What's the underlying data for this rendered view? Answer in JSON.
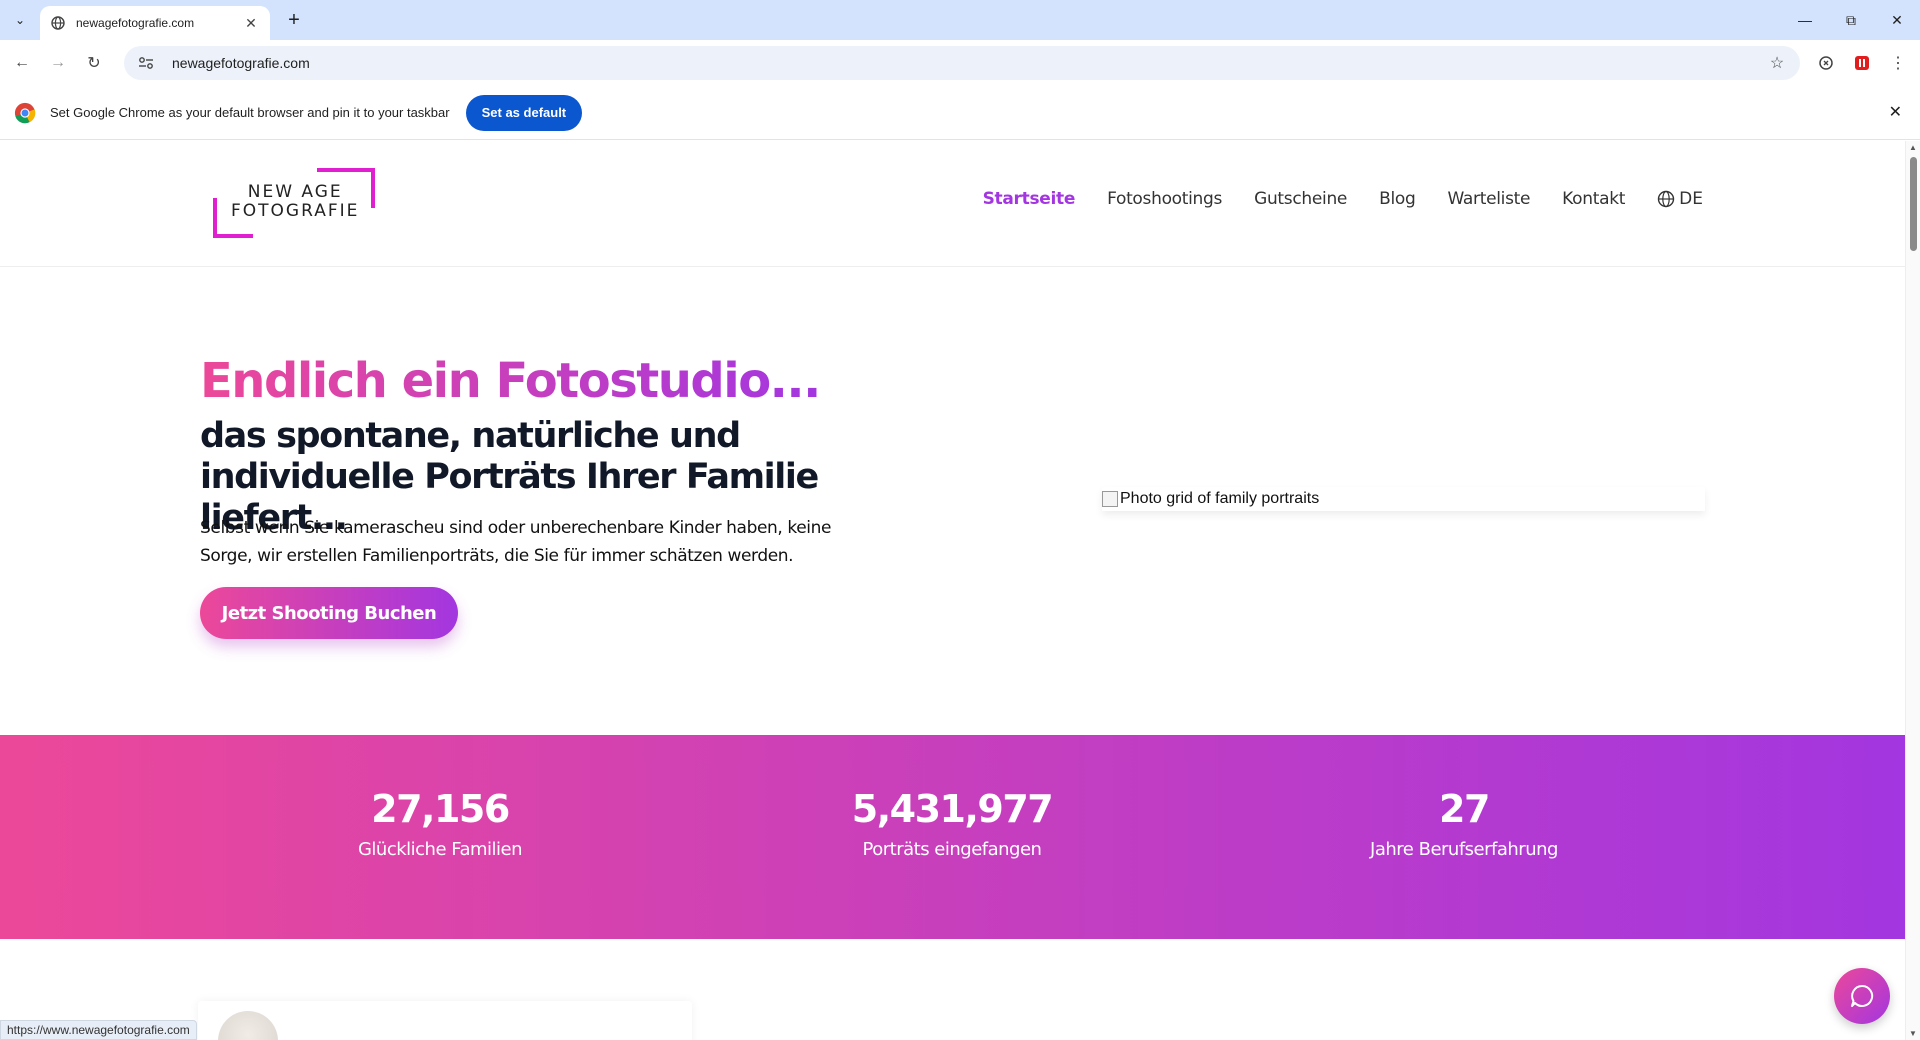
{
  "browser": {
    "tab_title": "newagefotografie.com",
    "url": "newagefotografie.com",
    "status_url": "https://www.newagefotografie.com",
    "infobar_message": "Set Google Chrome as your default browser and pin it to your taskbar",
    "infobar_button": "Set as default"
  },
  "site": {
    "logo": {
      "line1": "NEW AGE",
      "line2": "FOTOGRAFIE"
    },
    "nav": [
      {
        "label": "Startseite",
        "active": true
      },
      {
        "label": "Fotoshootings"
      },
      {
        "label": "Gutscheine"
      },
      {
        "label": "Blog"
      },
      {
        "label": "Warteliste"
      },
      {
        "label": "Kontakt"
      }
    ],
    "language": "DE",
    "accent_pink": "#ec4899",
    "accent_purple": "#a336e0"
  },
  "hero": {
    "headline": "Endlich ein Fotostudio...",
    "subheadline": "das spontane, natürliche und individuelle Porträts Ihrer Familie liefert...",
    "text": "Selbst wenn Sie kamerascheu sind oder unberechenbare Kinder haben, keine Sorge, wir erstellen Familienporträts, die Sie für immer schätzen werden.",
    "cta": "Jetzt Shooting Buchen",
    "image_alt": "Photo grid of family portraits"
  },
  "stats": [
    {
      "value": "27,156",
      "label": "Glückliche Familien"
    },
    {
      "value": "5,431,977",
      "label": "Porträts eingefangen"
    },
    {
      "value": "27",
      "label": "Jahre Berufserfahrung"
    }
  ]
}
